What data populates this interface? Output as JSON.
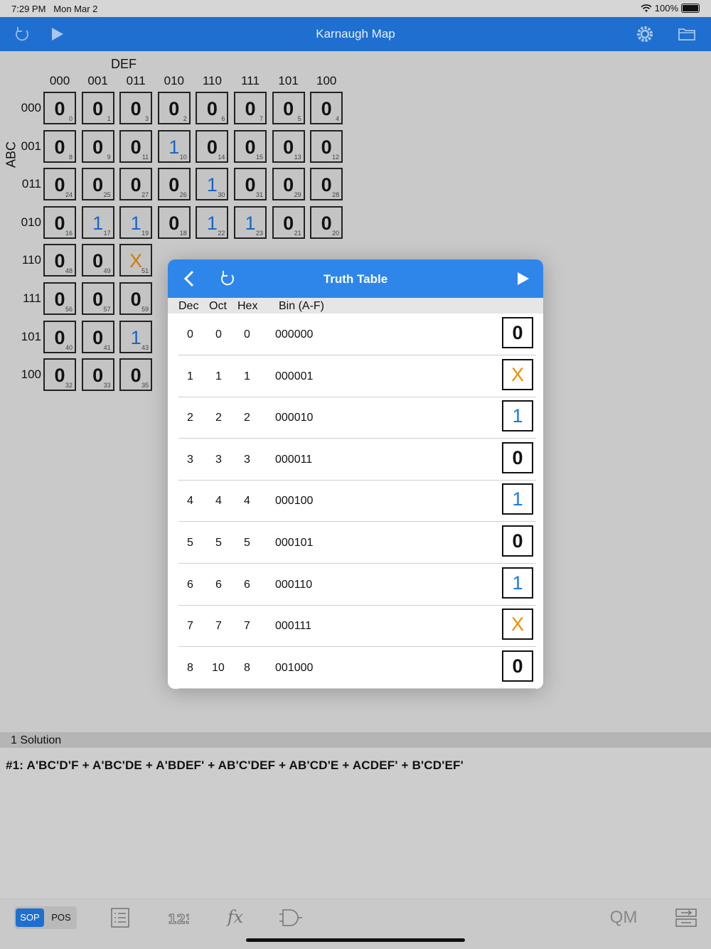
{
  "status": {
    "time": "7:29 PM",
    "date": "Mon Mar 2",
    "battery": "100%"
  },
  "nav": {
    "title": "Karnaugh Map"
  },
  "kmap": {
    "col_var": "DEF",
    "row_var": "ABC",
    "cols": [
      "000",
      "001",
      "011",
      "010",
      "110",
      "111",
      "101",
      "100"
    ],
    "rows": [
      "000",
      "001",
      "011",
      "010",
      "110",
      "111",
      "101",
      "100"
    ],
    "cells": [
      [
        {
          "v": "0",
          "i": "0"
        },
        {
          "v": "0",
          "i": "1"
        },
        {
          "v": "0",
          "i": "3"
        },
        {
          "v": "0",
          "i": "2"
        },
        {
          "v": "0",
          "i": "6"
        },
        {
          "v": "0",
          "i": "7"
        },
        {
          "v": "0",
          "i": "5"
        },
        {
          "v": "0",
          "i": "4"
        }
      ],
      [
        {
          "v": "0",
          "i": "8"
        },
        {
          "v": "0",
          "i": "9"
        },
        {
          "v": "0",
          "i": "11"
        },
        {
          "v": "1",
          "i": "10"
        },
        {
          "v": "0",
          "i": "14"
        },
        {
          "v": "0",
          "i": "15"
        },
        {
          "v": "0",
          "i": "13"
        },
        {
          "v": "0",
          "i": "12"
        }
      ],
      [
        {
          "v": "0",
          "i": "24"
        },
        {
          "v": "0",
          "i": "25"
        },
        {
          "v": "0",
          "i": "27"
        },
        {
          "v": "0",
          "i": "26"
        },
        {
          "v": "1",
          "i": "30"
        },
        {
          "v": "0",
          "i": "31"
        },
        {
          "v": "0",
          "i": "29"
        },
        {
          "v": "0",
          "i": "28"
        }
      ],
      [
        {
          "v": "0",
          "i": "16"
        },
        {
          "v": "1",
          "i": "17"
        },
        {
          "v": "1",
          "i": "19"
        },
        {
          "v": "0",
          "i": "18"
        },
        {
          "v": "1",
          "i": "22"
        },
        {
          "v": "1",
          "i": "23"
        },
        {
          "v": "0",
          "i": "21"
        },
        {
          "v": "0",
          "i": "20"
        }
      ],
      [
        {
          "v": "0",
          "i": "48"
        },
        {
          "v": "0",
          "i": "49"
        },
        {
          "v": "X",
          "i": "51"
        }
      ],
      [
        {
          "v": "0",
          "i": "56"
        },
        {
          "v": "0",
          "i": "57"
        },
        {
          "v": "0",
          "i": "59"
        }
      ],
      [
        {
          "v": "0",
          "i": "40"
        },
        {
          "v": "0",
          "i": "41"
        },
        {
          "v": "1",
          "i": "43"
        }
      ],
      [
        {
          "v": "0",
          "i": "32"
        },
        {
          "v": "0",
          "i": "33"
        },
        {
          "v": "0",
          "i": "35"
        }
      ]
    ]
  },
  "truth_table": {
    "title": "Truth Table",
    "headers": [
      "Dec",
      "Oct",
      "Hex",
      "Bin (A-F)"
    ],
    "rows": [
      {
        "dec": "0",
        "oct": "0",
        "hex": "0",
        "bin": "000000",
        "val": "0"
      },
      {
        "dec": "1",
        "oct": "1",
        "hex": "1",
        "bin": "000001",
        "val": "X"
      },
      {
        "dec": "2",
        "oct": "2",
        "hex": "2",
        "bin": "000010",
        "val": "1"
      },
      {
        "dec": "3",
        "oct": "3",
        "hex": "3",
        "bin": "000011",
        "val": "0"
      },
      {
        "dec": "4",
        "oct": "4",
        "hex": "4",
        "bin": "000100",
        "val": "1"
      },
      {
        "dec": "5",
        "oct": "5",
        "hex": "5",
        "bin": "000101",
        "val": "0"
      },
      {
        "dec": "6",
        "oct": "6",
        "hex": "6",
        "bin": "000110",
        "val": "1"
      },
      {
        "dec": "7",
        "oct": "7",
        "hex": "7",
        "bin": "000111",
        "val": "X"
      },
      {
        "dec": "8",
        "oct": "10",
        "hex": "8",
        "bin": "001000",
        "val": "0"
      }
    ]
  },
  "solution": {
    "header": "1 Solution",
    "line": "#1:  A'BC'D'F + A'BC'DE + A'BDEF' + AB'C'DEF + AB'CD'E + ACDEF' + B'CD'EF'"
  },
  "toolbar": {
    "sop": "SOP",
    "pos": "POS",
    "qm": "QM",
    "fx": "fx"
  },
  "colors": {
    "accent": "#1f6fd0",
    "popover_header": "#2f86ea",
    "one": "#1a7be0",
    "dontcare": "#ef8d00"
  }
}
